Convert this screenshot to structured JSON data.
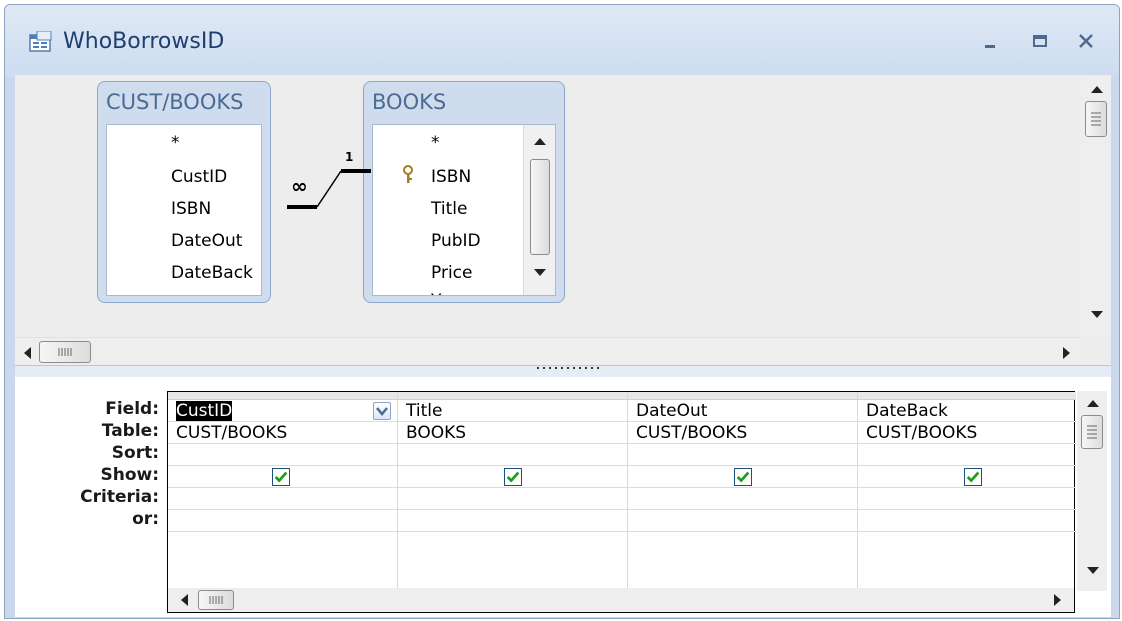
{
  "window": {
    "title": "WhoBorrowsID"
  },
  "tables": {
    "cust_books": {
      "title": "CUST/BOOKS",
      "fields": [
        "*",
        "CustID",
        "ISBN",
        "DateOut",
        "DateBack"
      ]
    },
    "books": {
      "title": "BOOKS",
      "fields": [
        "*",
        "ISBN",
        "Title",
        "PubID",
        "Price",
        "Year"
      ],
      "key_field": "ISBN"
    }
  },
  "relationship": {
    "many_label": "∞",
    "one_label": "1"
  },
  "grid": {
    "row_labels": [
      "Field:",
      "Table:",
      "Sort:",
      "Show:",
      "Criteria:",
      "or:"
    ],
    "columns": [
      {
        "field": "CustID",
        "table": "CUST/BOOKS",
        "sort": "",
        "show": true,
        "criteria": "",
        "or": ""
      },
      {
        "field": "Title",
        "table": "BOOKS",
        "sort": "",
        "show": true,
        "criteria": "",
        "or": ""
      },
      {
        "field": "DateOut",
        "table": "CUST/BOOKS",
        "sort": "",
        "show": true,
        "criteria": "",
        "or": ""
      },
      {
        "field": "DateBack",
        "table": "CUST/BOOKS",
        "sort": "",
        "show": true,
        "criteria": "",
        "or": ""
      }
    ]
  },
  "colors": {
    "window_border": "#8ea4bf",
    "title_text": "#1e3f6e",
    "table_title": "#4a6c93",
    "checkbox_tick": "#1aa01a"
  }
}
